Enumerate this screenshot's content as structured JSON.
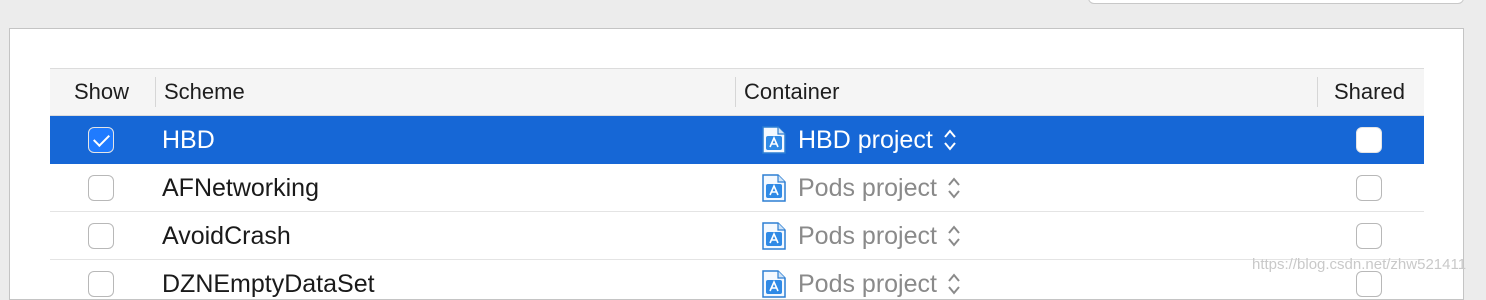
{
  "table": {
    "columns": [
      "Show",
      "Scheme",
      "Container",
      "Shared"
    ],
    "rows": [
      {
        "show": true,
        "scheme": "HBD",
        "container": "HBD project",
        "shared": false,
        "selected": true
      },
      {
        "show": false,
        "scheme": "AFNetworking",
        "container": "Pods project",
        "shared": false,
        "selected": false
      },
      {
        "show": false,
        "scheme": "AvoidCrash",
        "container": "Pods project",
        "shared": false,
        "selected": false
      },
      {
        "show": false,
        "scheme": "DZNEmptyDataSet",
        "container": "Pods project",
        "shared": false,
        "selected": false
      }
    ]
  },
  "icons": {
    "project": "xcode-project-icon",
    "stepper": "up-down-chevron-icon"
  },
  "colors": {
    "selection": "#1667d6",
    "checkbox_checked": "#1f7bff"
  },
  "watermark": "https://blog.csdn.net/zhw521411"
}
